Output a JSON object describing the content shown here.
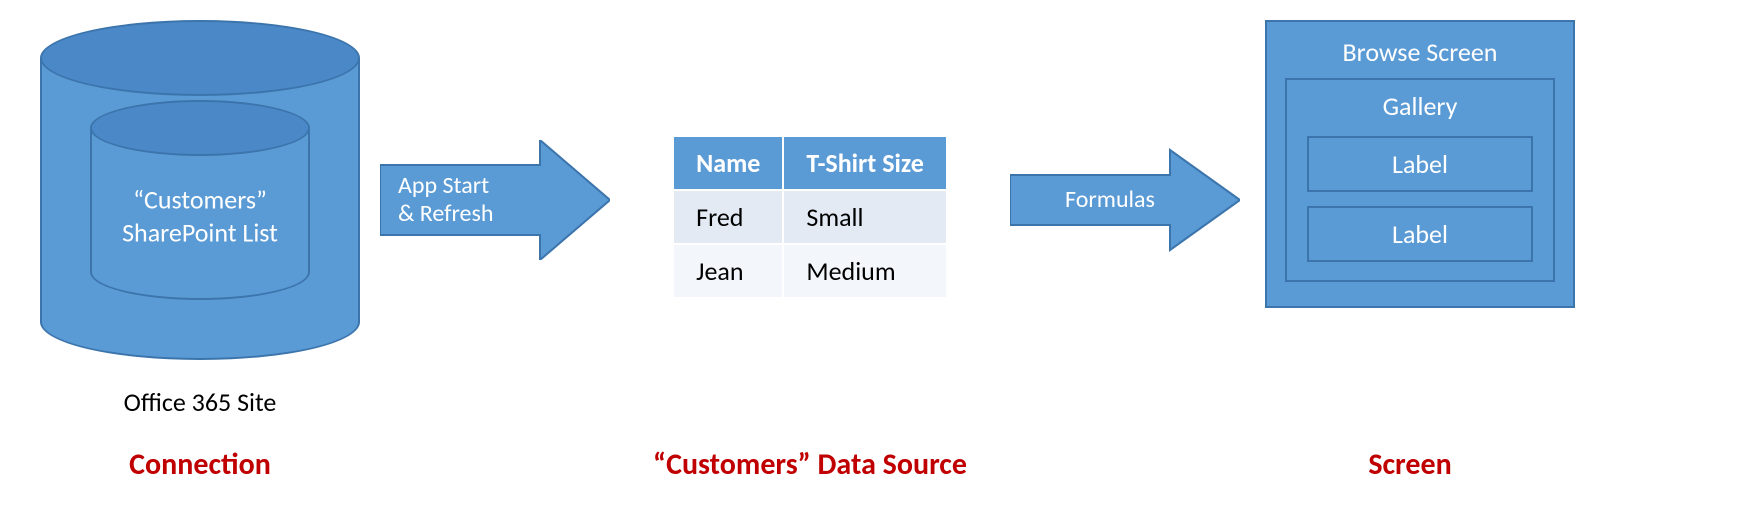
{
  "connection": {
    "inner_label_line1": "“Customers”",
    "inner_label_line2": "SharePoint List",
    "site_label": "Office 365 Site"
  },
  "arrow1": {
    "text": "App Start\n& Refresh"
  },
  "data_source": {
    "headers": [
      "Name",
      "T-Shirt Size"
    ],
    "rows": [
      [
        "Fred",
        "Small"
      ],
      [
        "Jean",
        "Medium"
      ]
    ]
  },
  "arrow2": {
    "text": "Formulas"
  },
  "screen": {
    "title": "Browse Screen",
    "gallery_title": "Gallery",
    "labels": [
      "Label",
      "Label"
    ]
  },
  "captions": {
    "connection": "Connection",
    "data_source": "“Customers” Data Source",
    "screen": "Screen"
  },
  "chart_data": {
    "type": "table",
    "title": "“Customers” Data Source",
    "columns": [
      "Name",
      "T-Shirt Size"
    ],
    "rows": [
      {
        "Name": "Fred",
        "T-Shirt Size": "Small"
      },
      {
        "Name": "Jean",
        "T-Shirt Size": "Medium"
      }
    ]
  }
}
